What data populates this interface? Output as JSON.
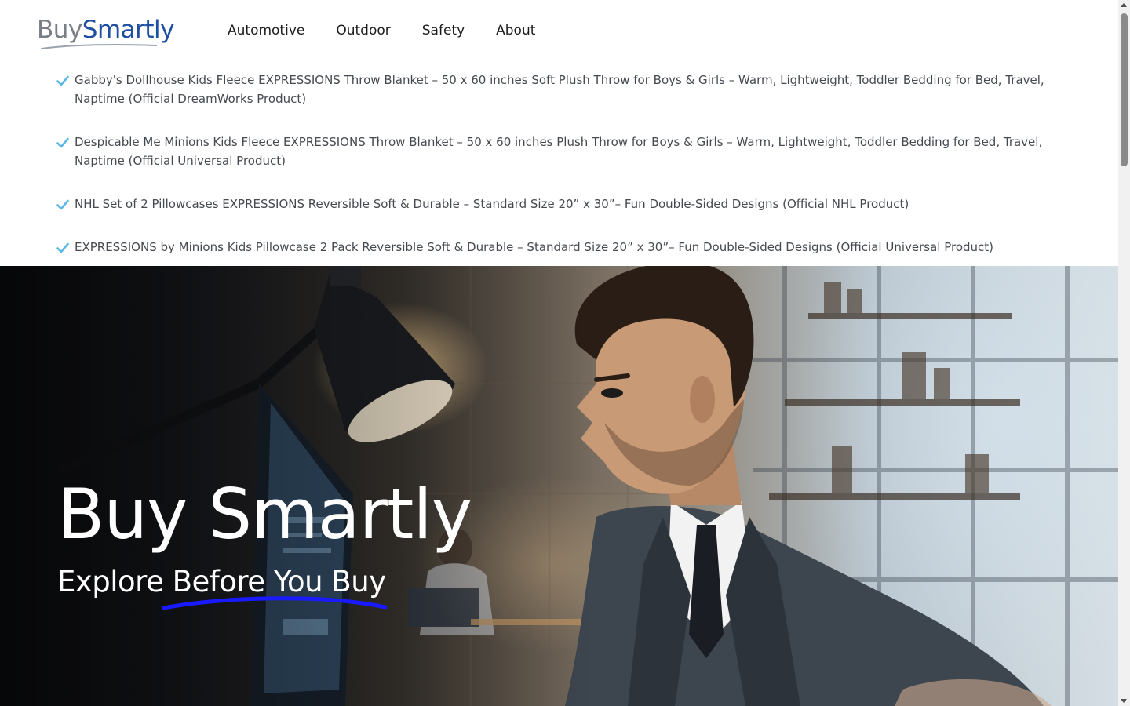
{
  "header": {
    "logo": {
      "part1": "Buy",
      "part2": "Smartly"
    },
    "nav": [
      {
        "label": "Automotive"
      },
      {
        "label": "Outdoor"
      },
      {
        "label": "Safety"
      },
      {
        "label": "About"
      }
    ]
  },
  "products": [
    {
      "text": "Gabby's Dollhouse Kids Fleece EXPRESSIONS Throw Blanket – 50 x 60 inches Soft Plush Throw for Boys & Girls – Warm, Lightweight, Toddler Bedding for Bed, Travel, Naptime (Official DreamWorks Product)"
    },
    {
      "text": "Despicable Me Minions Kids Fleece EXPRESSIONS Throw Blanket – 50 x 60 inches Plush Throw for Boys & Girls – Warm, Lightweight, Toddler Bedding for Bed, Travel, Naptime (Official Universal Product)"
    },
    {
      "text": "NHL Set of 2 Pillowcases EXPRESSIONS Reversible Soft & Durable – Standard Size 20” x 30”– Fun Double-Sided Designs (Official NHL Product)"
    },
    {
      "text": "EXPRESSIONS by Minions Kids Pillowcase 2 Pack Reversible Soft & Durable – Standard Size 20” x 30”– Fun Double-Sided Designs (Official Universal Product)"
    }
  ],
  "hero": {
    "title": "Buy Smartly",
    "subtitle": "Explore Before You Buy"
  },
  "colors": {
    "check": "#5bb7e6",
    "logo_grey": "#7a7f86",
    "logo_blue": "#1f4fa3",
    "underline": "#1a1aff"
  },
  "icons": {
    "check": "checkmark-icon",
    "lamp": "desk-lamp-icon"
  }
}
